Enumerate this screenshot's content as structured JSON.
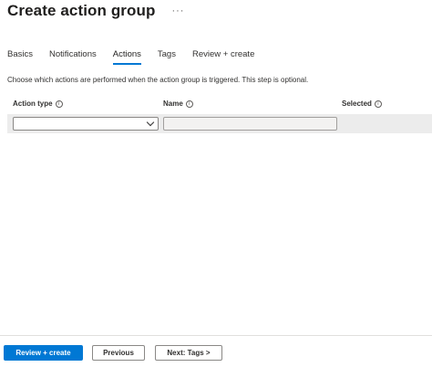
{
  "header": {
    "title": "Create action group",
    "more": "···"
  },
  "tabs": [
    {
      "label": "Basics"
    },
    {
      "label": "Notifications"
    },
    {
      "label": "Actions"
    },
    {
      "label": "Tags"
    },
    {
      "label": "Review + create"
    }
  ],
  "active_tab": "Actions",
  "description": "Choose which actions are performed when the action group is triggered. This step is optional.",
  "columns": {
    "action_type": "Action type",
    "name": "Name",
    "selected": "Selected"
  },
  "info_glyph": "i",
  "row": {
    "action_type_value": "",
    "name_value": ""
  },
  "footer": {
    "review_create": "Review + create",
    "previous": "Previous",
    "next": "Next: Tags >"
  },
  "colors": {
    "accent": "#0078d4",
    "row_bg": "#ececec"
  },
  "icons": [
    "more-icon",
    "info-icon",
    "chevron-down-icon"
  ]
}
